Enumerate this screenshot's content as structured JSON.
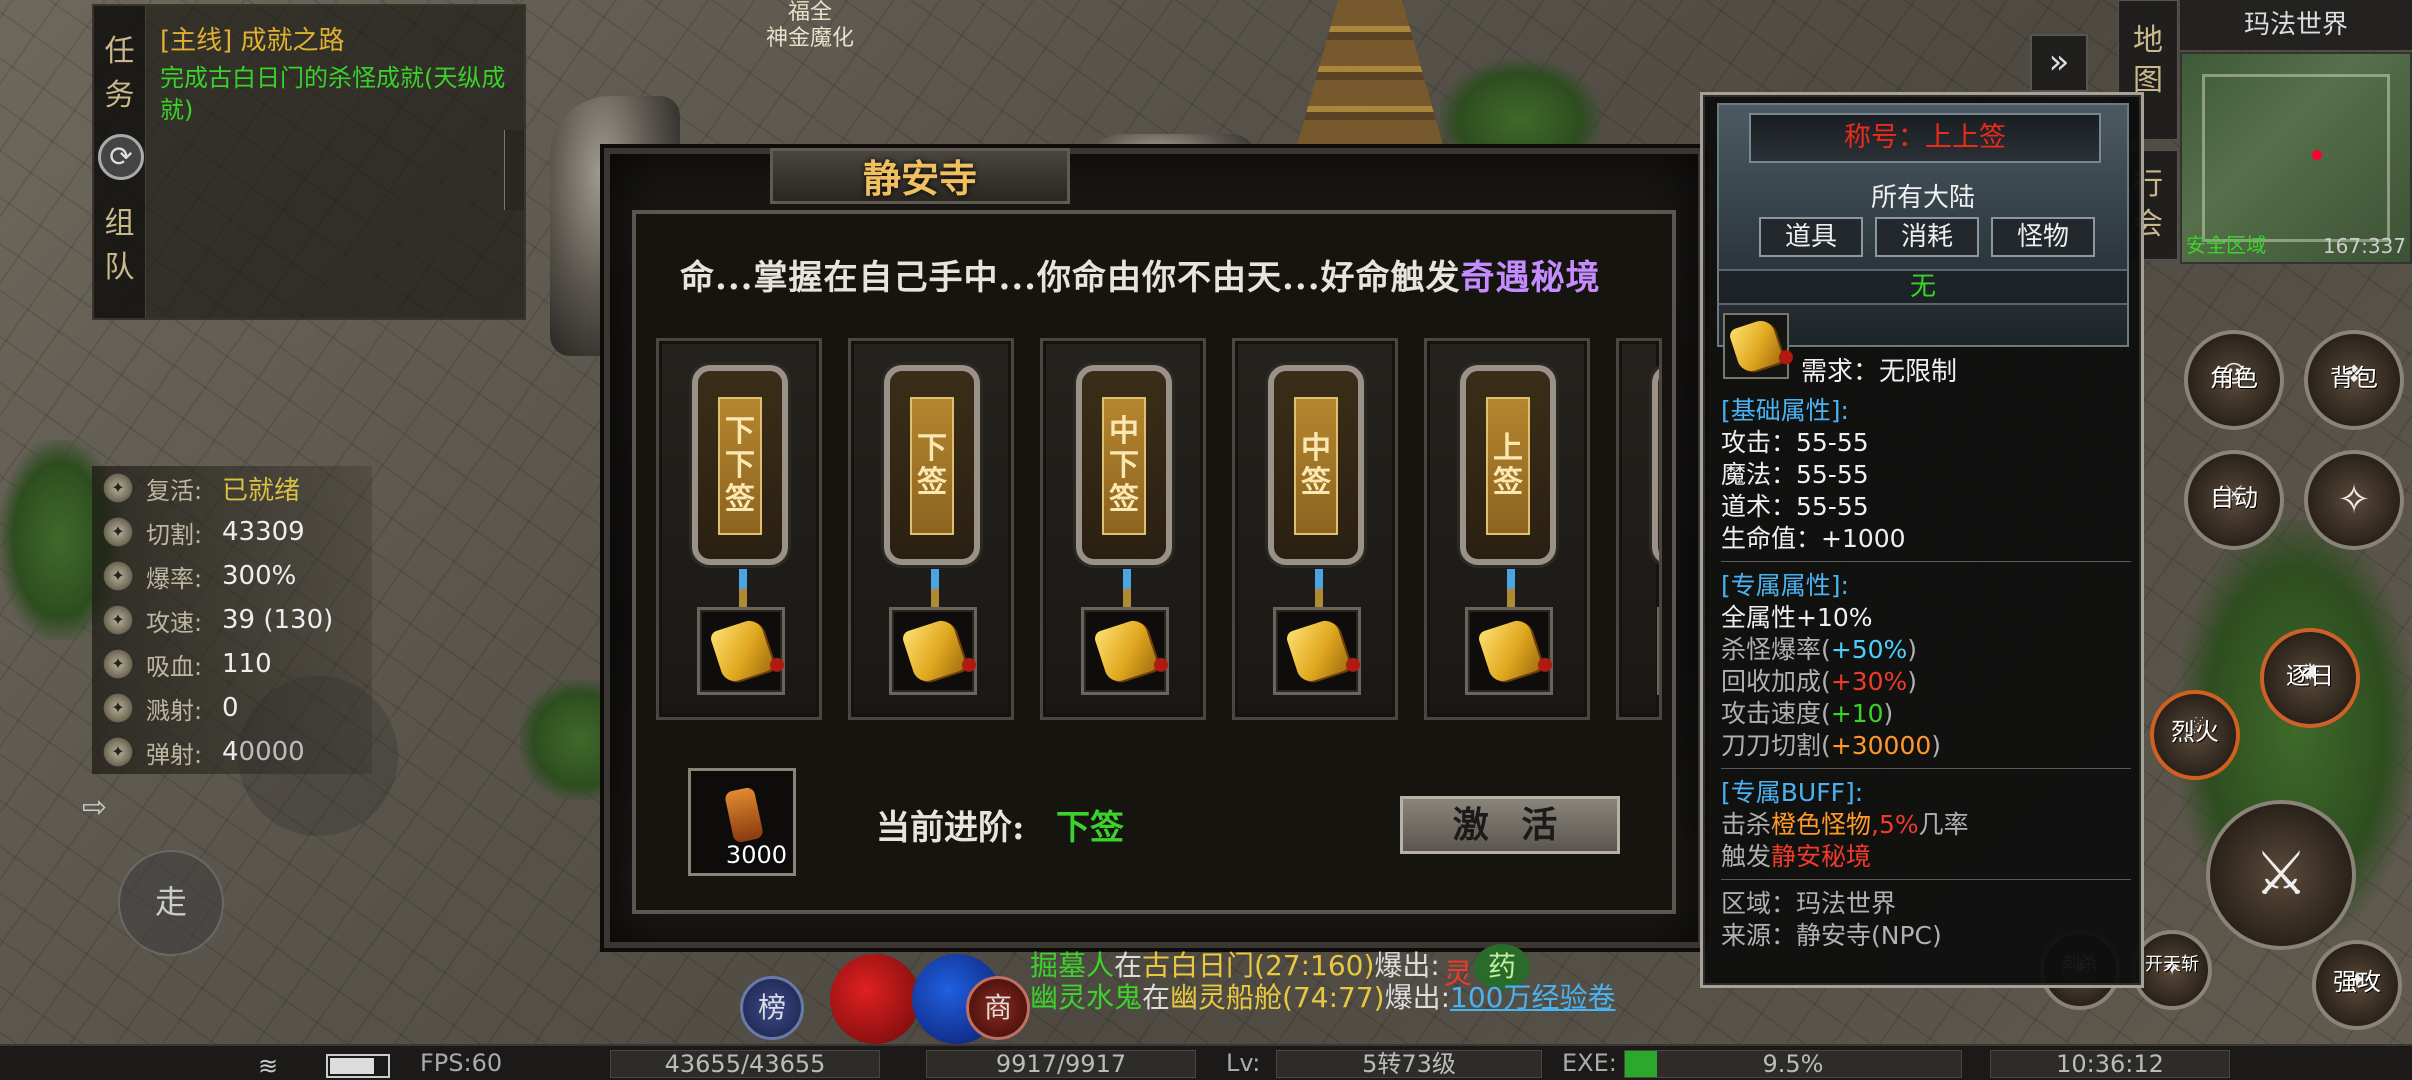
{
  "npc_label": {
    "line1": "福全",
    "line2": "神金魔化"
  },
  "quest": {
    "side_tabs": [
      "任",
      "务",
      "组",
      "队"
    ],
    "title": "[主线] 成就之路",
    "description": "完成古白日门的杀怪成就(天纵成就)"
  },
  "stats": [
    {
      "label": "复活:",
      "value": "已就绪",
      "icon": "revive-icon"
    },
    {
      "label": "切割:",
      "value": "43309",
      "icon": "cut-icon"
    },
    {
      "label": "爆率:",
      "value": "300%",
      "icon": "drop-rate-icon"
    },
    {
      "label": "攻速:",
      "value": "39 (130)",
      "icon": "attack-speed-icon"
    },
    {
      "label": "吸血:",
      "value": "110",
      "icon": "lifesteal-icon"
    },
    {
      "label": "溅射:",
      "value": "0",
      "icon": "splash-icon"
    },
    {
      "label": "弹射:",
      "value": "40000",
      "icon": "bounce-icon"
    }
  ],
  "walk_label": "走",
  "dialog": {
    "title": "静安寺",
    "intro_prefix": "命...掌握在自己手中...你命由你不由天...好命触发",
    "intro_highlight": "奇遇秘境",
    "cards": [
      {
        "chars": [
          "下",
          "下",
          "签"
        ]
      },
      {
        "chars": [
          "下",
          "签"
        ]
      },
      {
        "chars": [
          "中",
          "下",
          "签"
        ]
      },
      {
        "chars": [
          "中",
          "签"
        ]
      },
      {
        "chars": [
          "上",
          "签"
        ]
      },
      {
        "chars": [
          "上"
        ]
      }
    ],
    "item_count": "3000",
    "stage_label": "当前进阶:",
    "stage_value": "下签",
    "activate_label": "激 活"
  },
  "tooltip": {
    "title": "称号：上上签",
    "continent": "所有大陆",
    "categories": [
      "道具",
      "消耗",
      "怪物"
    ],
    "none": "无",
    "requirement": "需求：无限制",
    "base_header": "[基础属性]:",
    "base": [
      "攻击：55-55",
      "魔法：55-55",
      "道术：55-55",
      "生命值：+1000"
    ],
    "exclusive_header": "[专属属性]:",
    "exclusive_all": "全属性+10%",
    "exclusive": [
      {
        "name": "杀怪爆率",
        "value": "+50%",
        "color": "#4ed0ff"
      },
      {
        "name": "回收加成",
        "value": "+30%",
        "color": "#f03a2a"
      },
      {
        "name": "攻击速度",
        "value": "+10",
        "color": "#3cd22c"
      },
      {
        "name": "刀刀切割",
        "value": "+30000",
        "color": "#ff9a2a"
      }
    ],
    "buff_header": "[专属BUFF]:",
    "buff_line1": {
      "a": "击杀",
      "b": "橙色怪物",
      "c": ",",
      "d": "5%",
      "e": "几率"
    },
    "buff_line2": {
      "a": "触发",
      "b": "静安秘境"
    },
    "region": "区域：玛法世界",
    "source": "来源：静安寺(NPC)"
  },
  "minimap": {
    "title": "玛法世界",
    "safe": "安全区域",
    "coords": "167:337",
    "side_btn1": [
      "地",
      "图"
    ],
    "side_btn2": [
      "行",
      "会"
    ]
  },
  "right_buttons": [
    {
      "label": "角色",
      "icon": "character-icon"
    },
    {
      "label": "背包",
      "icon": "bag-icon"
    },
    {
      "label": "自动",
      "icon": "auto-icon"
    },
    {
      "label": "",
      "icon": "compass-icon"
    },
    {
      "label": "逐日",
      "icon": "skill-zhuri-icon"
    },
    {
      "label": "烈火",
      "icon": "skill-liehuo-icon"
    },
    {
      "label": "开天斩",
      "icon": "skill-kaitian-icon"
    },
    {
      "label": "刺杀",
      "icon": "skill-cisha-icon"
    },
    {
      "label": "强攻",
      "icon": "skill-qianggong-icon"
    }
  ],
  "bottom_buttons": {
    "rank": "榜",
    "shop": "商",
    "extra": "灵",
    "pill": "药"
  },
  "chat": [
    {
      "name": "掘墓人",
      "mid": "在",
      "place": "古白日门(27:160)",
      "post": "爆出:",
      "item": ""
    },
    {
      "name": "幽灵水鬼",
      "mid": "在",
      "place": "幽灵船舱(74:77)",
      "post": "爆出:",
      "item": "100万经验卷"
    }
  ],
  "status_bar": {
    "fps": "FPS:60",
    "hp": "43655/43655",
    "mp": "9917/9917",
    "lv_label": "Lv:",
    "level": "5转73级",
    "exe_label": "EXE:",
    "exp": "9.5%",
    "exp_fraction": 0.095,
    "time": "10:36:12"
  }
}
